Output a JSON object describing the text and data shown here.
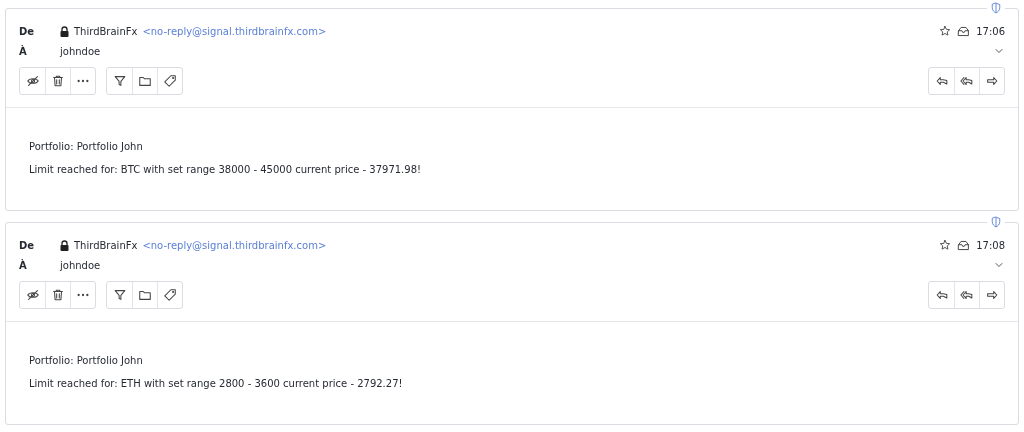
{
  "messages": [
    {
      "from_label": "De",
      "sender_name": "ThirdBrainFx",
      "sender_address": "<no-reply@signal.thirdbrainfx.com>",
      "to_label": "À",
      "recipient": "johndoe",
      "time": "17:06",
      "body": [
        "Portfolio: Portfolio John",
        "Limit reached for: BTC with set range 38000 - 45000 current price - 37971.98!"
      ]
    },
    {
      "from_label": "De",
      "sender_name": "ThirdBrainFx",
      "sender_address": "<no-reply@signal.thirdbrainfx.com>",
      "to_label": "À",
      "recipient": "johndoe",
      "time": "17:08",
      "body": [
        "Portfolio: Portfolio John",
        "Limit reached for: ETH with set range 2800 - 3600 current price - 2792.27!"
      ]
    }
  ]
}
